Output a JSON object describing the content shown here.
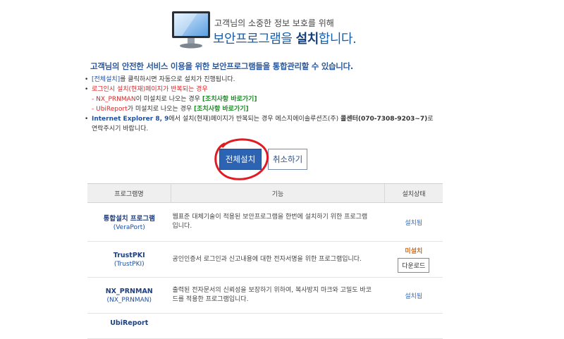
{
  "header": {
    "subtitle": "고객님의 소중한 정보 보호를 위해",
    "title_a": "보안프로그램",
    "title_b": "을 ",
    "title_c": "설치",
    "title_d": "합니다."
  },
  "intro": "고객님의 안전한 서비스 이용을 위한 보안프로그램들을 통합관리할 수 있습니다.",
  "notes": {
    "n1_link": "[전체설치]",
    "n1_text": "를 클릭하시면 자동으로 설치가 진행됩니다.",
    "n2_text": "로그인시 설치(현재)페이지가 반복되는 경우",
    "n2a_prefix": "- NX_PRNMAN",
    "n2a_text": "이 미설치로 나오는 경우 ",
    "n2a_link": "[조치사항 바로가기]",
    "n2b_prefix": "- UbiReport",
    "n2b_text": "가 미설치로 나오는 경우 ",
    "n2b_link": "[조치사항 바로가기]",
    "n3_browser": "Internet Explorer 8, 9",
    "n3_text": "에서 설치(현재)페이지가 반복되는 경우 에스지에이솔루션즈(주) ",
    "n3_center": "콜센터(070-7308-9203~7)",
    "n3_end": "로",
    "n3_line2": "연락주시기 바랍니다."
  },
  "buttons": {
    "install_all": "전체설치",
    "cancel": "취소하기"
  },
  "table": {
    "headers": [
      "프로그램명",
      "기능",
      "설치상태"
    ],
    "rows": [
      {
        "name": "통합설치 프로그램",
        "sub": "(VeraPort)",
        "func": "웹표준 대체기술이 적용된 보안프로그램을 한번에 설치하기 위한 프로그램입니다.",
        "status": "설치됨"
      },
      {
        "name": "TrustPKI",
        "sub": "(TrustPKI)",
        "func": "공인인증서 로그인과 신고내용에 대한 전자서명을 위한 프로그램입니다.",
        "status": "미설치",
        "download": "다운로드"
      },
      {
        "name": "NX_PRNMAN",
        "sub": "(NX_PRNMAN)",
        "func": "출력된 전자문서의 신뢰성을 보장하기 위하여, 복사방지 마크와 고밀도 바코드를 적용한 프로그램입니다.",
        "status": "설치됨"
      },
      {
        "name": "UbiReport",
        "sub": "",
        "func": "",
        "status": ""
      }
    ]
  },
  "colors": {
    "title_blue": "#1a5fa8",
    "install_button": "#2d63b3",
    "red_circle": "#e11b22",
    "missing_orange": "#d46a10"
  },
  "icons": {
    "monitor": "monitor-icon",
    "bullet": "bullet-icon"
  }
}
